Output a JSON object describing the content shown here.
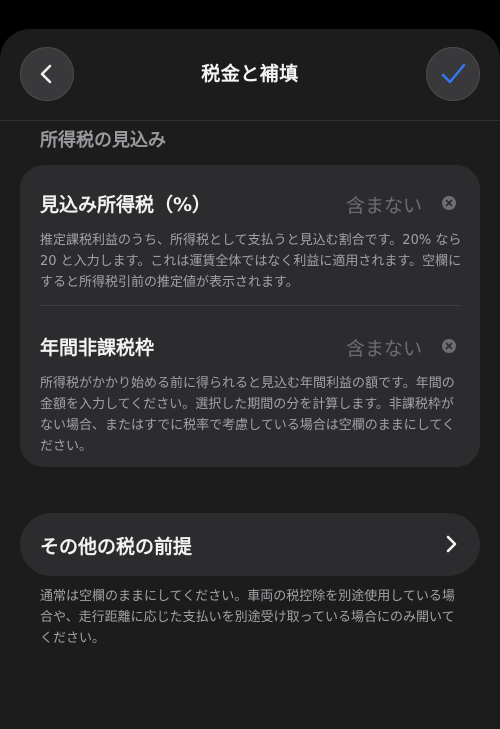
{
  "header": {
    "title": "税金と補填",
    "back_icon": "chevron-left-icon",
    "confirm_icon": "checkmark-icon",
    "accent_color": "#2f7bf5"
  },
  "income_tax_section": {
    "title": "所得税の見込み",
    "rows": [
      {
        "label": "見込み所得税（%）",
        "value_placeholder": "含まない",
        "description": "推定課税利益のうち、所得税として支払うと見込む割合です。20% なら 20 と入力します。これは運賃全体ではなく利益に適用されます。空欄にすると所得税引前の推定値が表示されます。"
      },
      {
        "label": "年間非課税枠",
        "value_placeholder": "含まない",
        "description": "所得税がかかり始める前に得られると見込む年間利益の額です。年間の金額を入力してください。選択した期間の分を計算します。非課税枠がない場合、またはすでに税率で考慮している場合は空欄のままにしてください。"
      }
    ]
  },
  "other_tax": {
    "label": "その他の税の前提",
    "icon": "chevron-right-icon",
    "note": "通常は空欄のままにしてください。車両の税控除を別途使用している場合や、走行距離に応じた支払いを別途受け取っている場合にのみ開いてください。"
  }
}
